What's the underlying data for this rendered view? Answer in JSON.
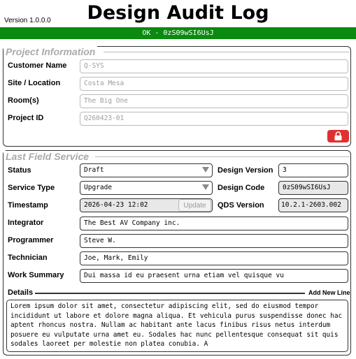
{
  "header": {
    "version": "Version 1.0.0.0",
    "title": "Design Audit Log",
    "status": "OK - 0zS09wSI6UsJ"
  },
  "project": {
    "legend": "Project Information",
    "customer_label": "Customer Name",
    "customer_value": "Q-SYS",
    "site_label": "Site / Location",
    "site_value": "Costa Mesa",
    "room_label": "Room(s)",
    "room_value": "The Big One",
    "project_id_label": "Project ID",
    "project_id_value": "Q260423-01",
    "lock_icon": "lock-icon"
  },
  "service": {
    "legend": "Last Field Service",
    "status_label": "Status",
    "status_value": "Draft",
    "service_type_label": "Service Type",
    "service_type_value": "Upgrade",
    "timestamp_label": "Timestamp",
    "timestamp_value": "2026-04-23 12:02",
    "update_label": "Update",
    "design_version_label": "Design Version",
    "design_version_value": "3",
    "design_code_label": "Design Code",
    "design_code_value": "0zS09wSI6UsJ",
    "qds_version_label": "QDS Version",
    "qds_version_value": "10.2.1-2603.002",
    "integrator_label": "Integrator",
    "integrator_value": "The Best AV Company inc.",
    "programmer_label": "Programmer",
    "programmer_value": "Steve W.",
    "technician_label": "Technician",
    "technician_value": "Joe, Mark, Emily",
    "work_summary_label": "Work Summary",
    "work_summary_value": "Dui massa id eu praesent urna etiam vel quisque vu",
    "details_label": "Details",
    "add_line_label": "Add New Line",
    "details_value": "Lorem ipsum dolor sit amet, consectetur adipiscing elit, sed do eiusmod tempor incididunt ut labore et dolore magna aliqua. Et vehicula purus suspendisse donec hac aptent rhoncus nostra. Nullam ac habitant ante lacus finibus risus netus interdum posuere eu vulputate urna amet eu. Sodales hac nunc pellentesque consequat sit quis sodales laoreet per molestie non platea conubia. A"
  },
  "colors": {
    "status_bar": "#0b8a10",
    "lock_button": "#e03131",
    "legend_text": "#aaaaaa"
  }
}
